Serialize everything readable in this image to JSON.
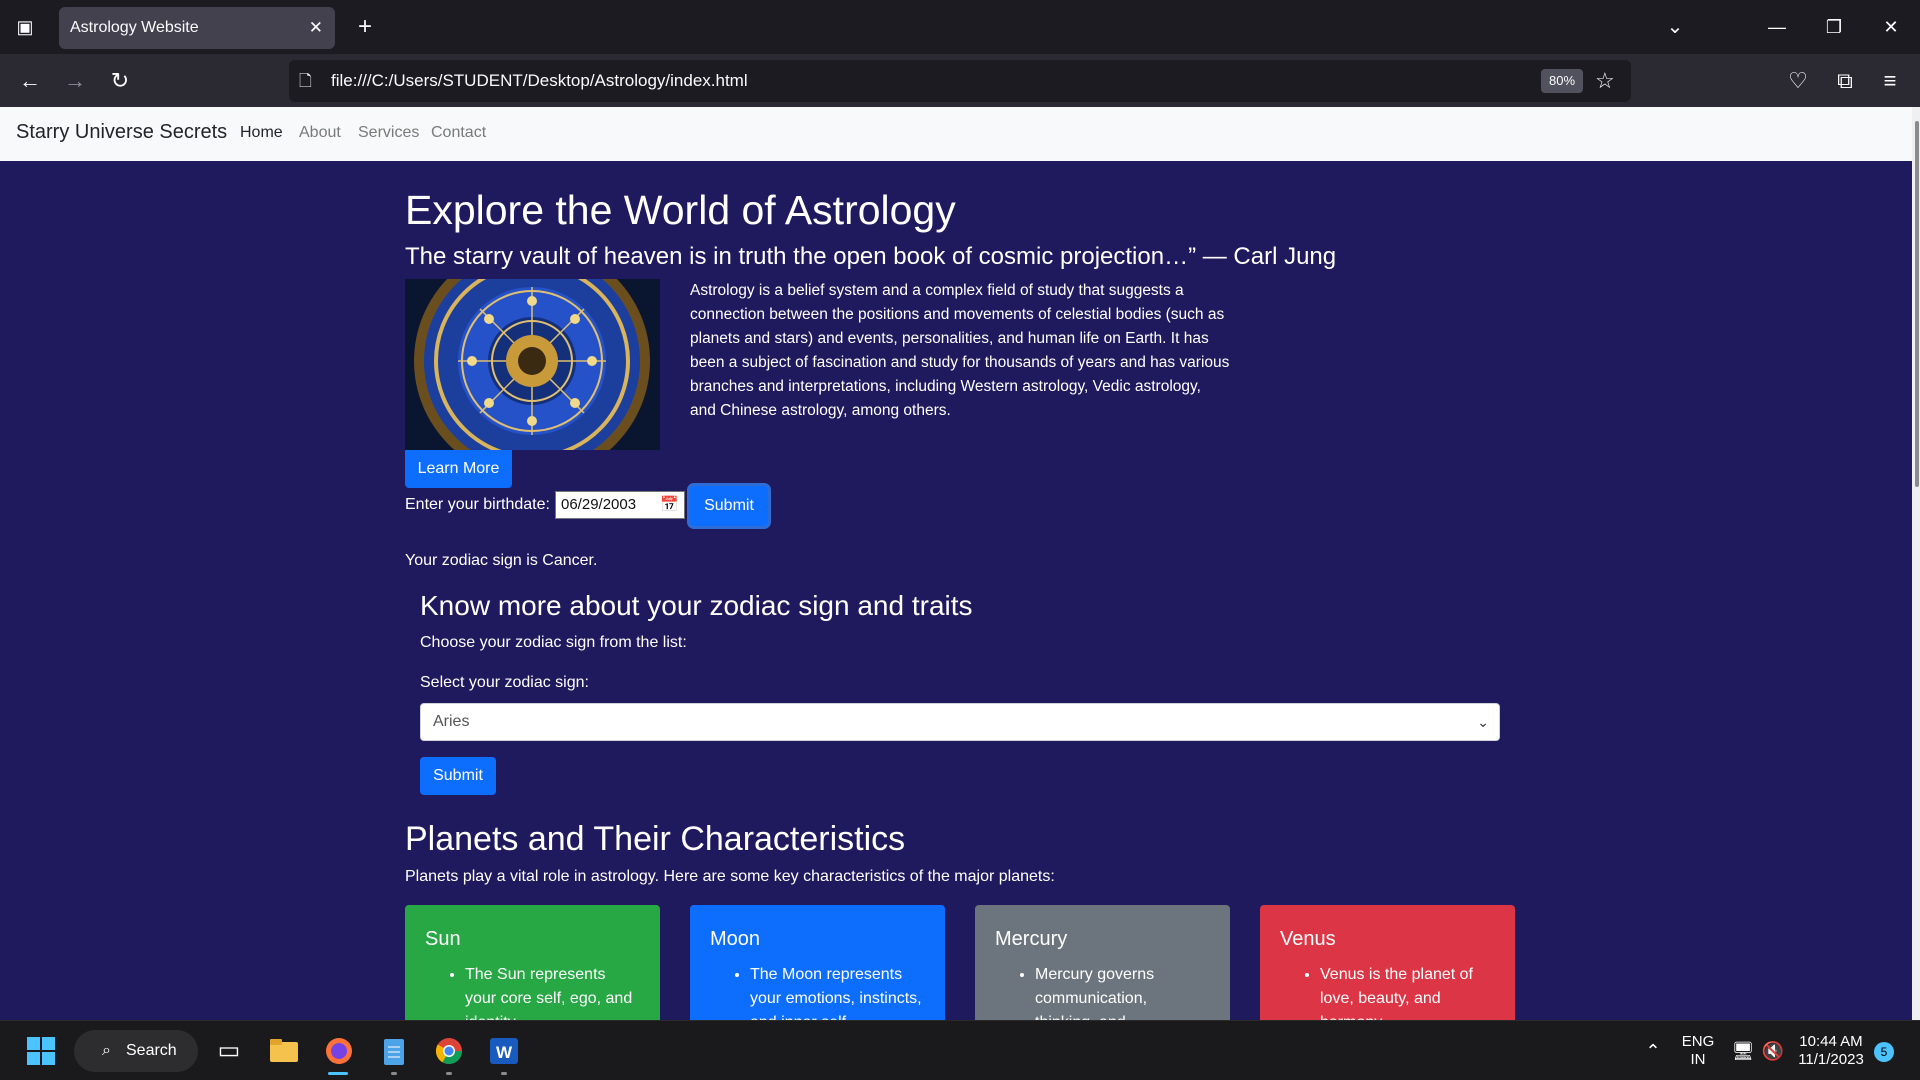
{
  "browser": {
    "tab_title": "Astrology Website",
    "url": "file:///C:/Users/STUDENT/Desktop/Astrology/index.html",
    "zoom": "80%"
  },
  "site": {
    "brand": "Starry Universe Secrets",
    "nav": [
      "Home",
      "About",
      "Services",
      "Contact"
    ],
    "active_nav": "Home"
  },
  "hero": {
    "title": "Explore the World of Astrology",
    "quote": "The starry vault of heaven is in truth the open book of cosmic projection…” — Carl Jung",
    "paragraph": "Astrology is a belief system and a complex field of study that suggests a connection between the positions and movements of celestial bodies (such as planets and stars) and events, personalities, and human life on Earth. It has been a subject of fascination and study for thousands of years and has various branches and interpretations, including Western astrology, Vedic astrology, and Chinese astrology, among others.",
    "learn_more": "Learn More"
  },
  "birthdate": {
    "label": "Enter your birthdate:",
    "value": "06/29/2003",
    "submit": "Submit",
    "result": "Your zodiac sign is Cancer."
  },
  "zodiac": {
    "heading": "Know more about your zodiac sign and traits",
    "instruction": "Choose your zodiac sign from the list:",
    "select_label": "Select your zodiac sign:",
    "selected": "Aries",
    "submit": "Submit"
  },
  "planets": {
    "heading": "Planets and Their Characteristics",
    "intro": "Planets play a vital role in astrology. Here are some key characteristics of the major planets:",
    "cards": [
      {
        "name": "Sun",
        "text": "The Sun represents your core self, ego, and identity.",
        "color": "#28a745"
      },
      {
        "name": "Moon",
        "text": "The Moon represents your emotions, instincts, and inner self.",
        "color": "#0d6efd"
      },
      {
        "name": "Mercury",
        "text": "Mercury governs communication, thinking, and",
        "color": "#6c757d"
      },
      {
        "name": "Venus",
        "text": "Venus is the planet of love, beauty, and harmony.",
        "color": "#dc3545"
      }
    ]
  },
  "taskbar": {
    "search": "Search",
    "lang_top": "ENG",
    "lang_bottom": "IN",
    "time": "10:44 AM",
    "date": "11/1/2023",
    "notifications": "5"
  }
}
